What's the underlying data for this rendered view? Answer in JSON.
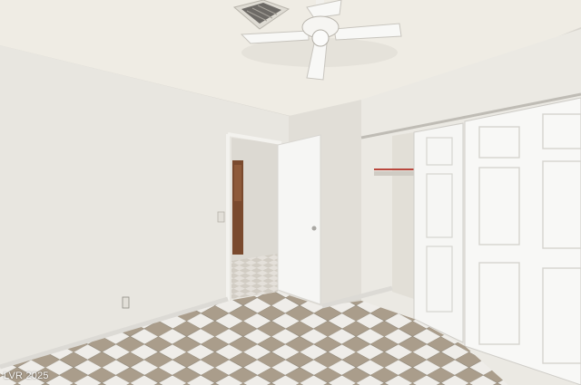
{
  "photo": {
    "watermark": "LVR 2025"
  },
  "palette": {
    "ceiling": "#efece4",
    "wall_left": "#e9e7e1",
    "wall_right": "#ebe9e3",
    "door": "#f6f6f4",
    "tile_light": "#efede9",
    "tile_dark": "#aa9d8b",
    "baseboard": "#dcdad5"
  }
}
